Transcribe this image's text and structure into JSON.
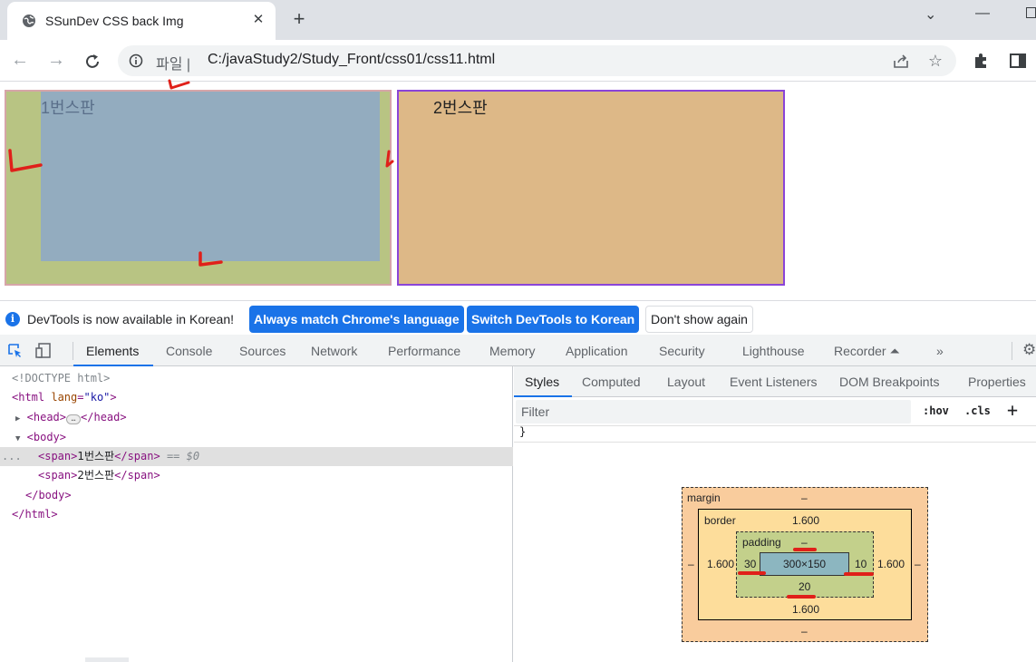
{
  "browser": {
    "tab_title": "SSunDev CSS back Img",
    "tab_close": "✕",
    "new_tab": "+",
    "window_caret": "⌄",
    "window_minimize": "—",
    "url_scheme": "파일 |",
    "url": "C:/javaStudy2/Study_Front/css01/css11.html"
  },
  "page": {
    "box1_label": "1번스판",
    "box2_label": "2번스판"
  },
  "infobar": {
    "message": "DevTools is now available in Korean!",
    "btn_match": "Always match Chrome's language",
    "btn_switch": "Switch DevTools to Korean",
    "btn_dismiss": "Don't show again"
  },
  "devtools": {
    "tabs": [
      "Elements",
      "Console",
      "Sources",
      "Network",
      "Performance",
      "Memory",
      "Application",
      "Security",
      "Lighthouse",
      "Recorder ⏶",
      "»"
    ],
    "active_tab": "Elements",
    "dom": {
      "doctype": "<!DOCTYPE html>",
      "html_open": "<html",
      "html_attr_name": "lang",
      "html_attr_value": "\"ko\"",
      "head": "<head>",
      "head_close": "</head>",
      "body_open": "<body>",
      "span_open": "<span>",
      "span_close": "</span>",
      "span1_text": "1번스판",
      "span2_text": "2번스판",
      "selected_marker": "== $0",
      "body_close": "</body>",
      "html_close": "</html>",
      "ellipsis": "..."
    },
    "styles_tabs": [
      "Styles",
      "Computed",
      "Layout",
      "Event Listeners",
      "DOM Breakpoints",
      "Properties"
    ],
    "active_styles_tab": "Styles",
    "filter_placeholder": "Filter",
    "hov": ":hov",
    "cls": ".cls",
    "add": "+",
    "brace": "}",
    "box_model": {
      "margin_label": "margin",
      "margin_top": "–",
      "margin_bottom": "–",
      "margin_left": "–",
      "margin_right": "–",
      "border_label": "border",
      "border_top": "1.600",
      "border_bottom": "1.600",
      "border_left": "1.600",
      "border_right": "1.600",
      "padding_label": "padding",
      "padding_top": "–",
      "padding_bottom": "20",
      "padding_left": "30",
      "padding_right": "10",
      "content": "300×150"
    }
  },
  "colors": {
    "accent": "#1a73e8",
    "box1_outer": "#b8c483",
    "box1_content": "#93acbf",
    "box2_bg": "#ddb887",
    "box2_border": "#8a44d8",
    "annotation_red": "#e0201a"
  }
}
